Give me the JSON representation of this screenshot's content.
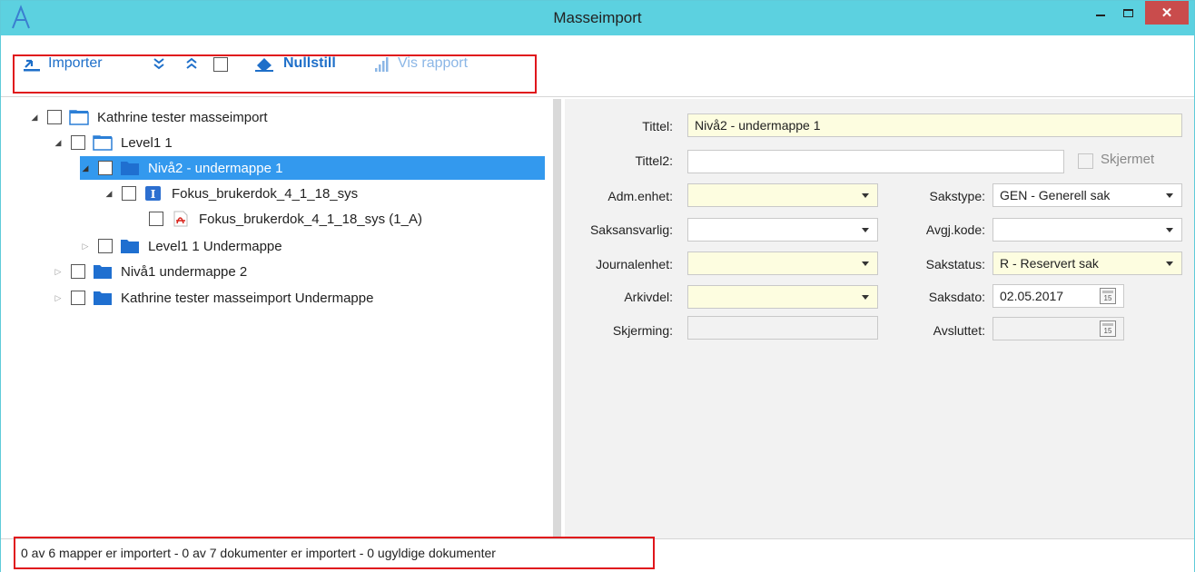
{
  "window": {
    "title": "Masseimport"
  },
  "toolbar": {
    "import_label": "Importer",
    "reset_label": "Nullstill",
    "report_label": "Vis rapport"
  },
  "tree": {
    "nodes": [
      {
        "label": "Kathrine tester masseimport",
        "expander": "expanded",
        "icon": "folder-open-icon"
      },
      {
        "label": "Level1 1",
        "expander": "expanded",
        "icon": "folder-open-icon"
      },
      {
        "label": "Nivå2 - undermappe 1",
        "expander": "expanded",
        "icon": "folder-icon",
        "selected": true
      },
      {
        "label": "Fokus_brukerdok_4_1_18_sys",
        "expander": "expanded",
        "icon": "document-info-icon"
      },
      {
        "label": "Fokus_brukerdok_4_1_18_sys (1_A)",
        "expander": "none",
        "icon": "pdf-icon"
      },
      {
        "label": "Level1 1 Undermappe",
        "expander": "collapsed",
        "icon": "folder-icon"
      },
      {
        "label": "Nivå1 undermappe 2",
        "expander": "collapsed",
        "icon": "folder-icon"
      },
      {
        "label": "Kathrine tester masseimport Undermappe",
        "expander": "collapsed",
        "icon": "folder-icon"
      }
    ]
  },
  "form": {
    "tittel_label": "Tittel:",
    "tittel_value": "Nivå2 - undermappe 1",
    "tittel2_label": "Tittel2:",
    "tittel2_value": "",
    "skjermet_label": "Skjermet",
    "adm_label": "Adm.enhet:",
    "adm_value": "",
    "saksansvarlig_label": "Saksansvarlig:",
    "saksansvarlig_value": "",
    "journalenhet_label": "Journalenhet:",
    "journalenhet_value": "",
    "arkivdel_label": "Arkivdel:",
    "arkivdel_value": "",
    "skjerming_label": "Skjerming:",
    "skjerming_value": "",
    "sakstype_label": "Sakstype:",
    "sakstype_value": "GEN - Generell sak",
    "avgj_label": "Avgj.kode:",
    "avgj_value": "",
    "sakstatus_label": "Sakstatus:",
    "sakstatus_value": "R - Reservert sak",
    "saksdato_label": "Saksdato:",
    "saksdato_value": "02.05.2017",
    "avsluttet_label": "Avsluttet:",
    "avsluttet_value": "",
    "calendar_day": "15"
  },
  "status": {
    "text": "0 av 6 mapper er importert  -  0 av 7 dokumenter er importert  -  0 ugyldige dokumenter"
  },
  "colors": {
    "titlebar": "#5cd1e0",
    "accent": "#1e6fc9",
    "selection": "#3399ee",
    "required_field": "#fdfde0",
    "highlight_box": "#e0161c",
    "close_button": "#c94c4c"
  }
}
